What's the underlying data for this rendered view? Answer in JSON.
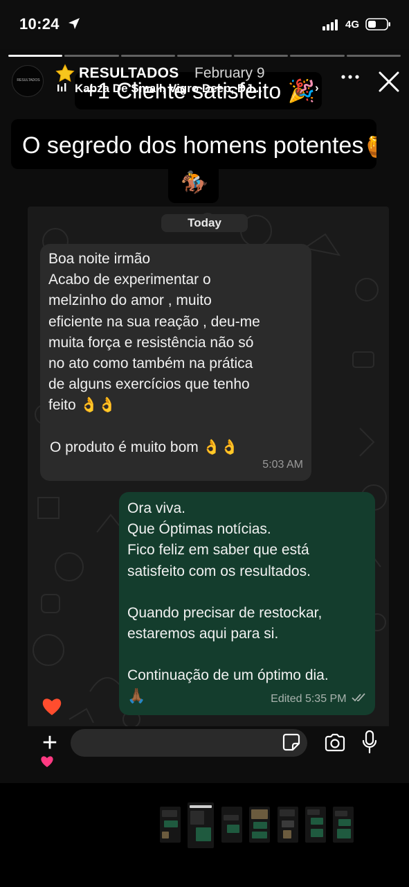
{
  "status_bar": {
    "time": "10:24",
    "network": "4G"
  },
  "story": {
    "progress_segments_total": 7,
    "progress_segments_viewed": 1,
    "highlight_title": "RESULTADOS",
    "date": "February 9",
    "music": "Kabza De Small, Vigro Deep, DJ...",
    "music_chevron": "›",
    "avatar_text": "RESULTADOS",
    "captions": [
      "+1 Cliente satisfeito 🎉",
      "O segredo dos homens potentes🍯",
      "🏇"
    ]
  },
  "chat": {
    "day_label": "Today",
    "incoming": {
      "lines": [
        "Boa noite irmão",
        "Acabo de experimentar o",
        "melzinho do amor , muito",
        "eficiente na sua reação , deu-me",
        "muita força e resistência não só",
        "no ato como também na prática",
        "de alguns exercícios que tenho",
        "feito 👌👌"
      ],
      "closing": "O produto é muito bom 👌👌",
      "time": "5:03 AM"
    },
    "outgoing": {
      "paragraphs": [
        [
          "Ora viva.",
          "Que Óptimas notícias.",
          "Fico feliz em saber que está",
          "satisfeito com os resultados."
        ],
        [
          "Quando precisar de restockar,",
          "estaremos aqui para si."
        ],
        [
          "Continuação de um óptimo dia.",
          "🙏🏾"
        ]
      ],
      "meta": "Edited 5:35 PM",
      "read_status": "read"
    }
  },
  "reply_bar": {
    "reaction_emoji": "❤️",
    "add_label": "+"
  },
  "colors": {
    "incoming_bubble": "#2b2b2b",
    "outgoing_bubble": "#143d2d",
    "heart": "#ff4d2e",
    "pink_heart": "#ff3a82"
  },
  "icons": [
    "location-arrow-icon",
    "signal-icon",
    "battery-icon",
    "star-icon",
    "music-bars-icon",
    "more-icon",
    "close-icon",
    "sticker-icon",
    "camera-icon",
    "microphone-icon",
    "heart-icon",
    "pink-heart-icon",
    "double-check-icon"
  ],
  "thumbnails": {
    "count": 7,
    "active_index": 1
  }
}
